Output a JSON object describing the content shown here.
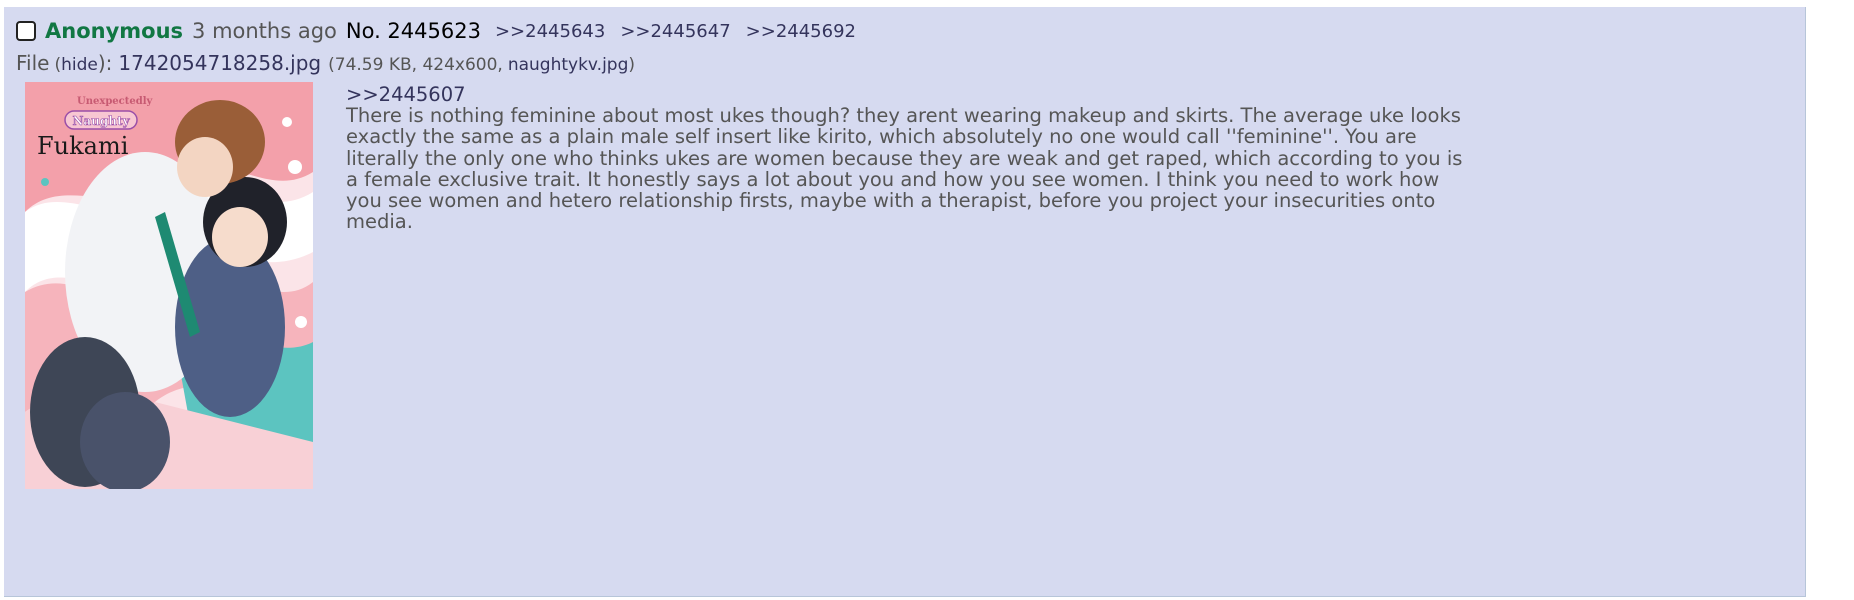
{
  "post": {
    "name": "Anonymous",
    "date": "3 months ago",
    "number": "No. 2445623",
    "backlinks": [
      ">>2445643",
      ">>2445647",
      ">>2445692"
    ]
  },
  "file": {
    "label": "File",
    "hide_prefix": "(",
    "hide_label": "hide",
    "hide_suffix": "):",
    "filename": "1742054718258.jpg",
    "meta_prefix": "(74.59 KB, 424x600,",
    "original_name": "naughtykv.jpg",
    "meta_suffix": ")"
  },
  "thumbnail": {
    "cover_small_text": "Unexpectedly",
    "cover_badge": "Naughty",
    "cover_title": "Fukami"
  },
  "comment": {
    "quote": ">>2445607",
    "body": "There is nothing feminine about most ukes though? they arent wearing makeup and skirts. The average uke looks exactly the same as a plain male self insert like kirito, which absolutely no one would call ''feminine''. You are literally the only one who thinks ukes are women because they are weak and get raped, which according to you is a female exclusive trait. It honestly says a lot about you and how you see women. I think you need to work how you see women and hetero relationship firsts, maybe with a therapist, before you project your insecurities onto media."
  },
  "colors": {
    "post_bg": "#d6daf0",
    "name": "#117743",
    "link": "#34345c",
    "text": "#555555"
  }
}
